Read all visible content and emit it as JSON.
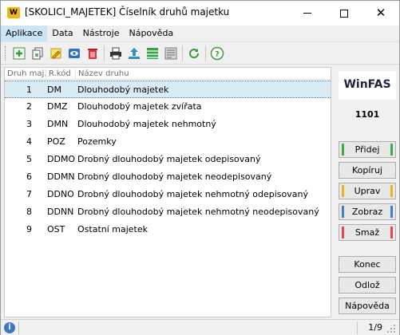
{
  "window": {
    "logo_text": "W",
    "title": "[SKOLICI_MAJETEK] Číselník druhů majetku"
  },
  "menu": [
    "Aplikace",
    "Data",
    "Nástroje",
    "Nápověda"
  ],
  "toolbar": {
    "icons": [
      "add-icon",
      "copy-icon",
      "edit-icon",
      "view-icon",
      "delete-icon",
      "print-icon",
      "export-icon",
      "table-icon",
      "form-icon",
      "refresh-icon",
      "help-icon"
    ]
  },
  "grid": {
    "columns": [
      "Druh maj.",
      "R.kód",
      "Název druhu"
    ],
    "rows": [
      {
        "num": "1",
        "code": "DM",
        "name": "Dlouhodobý majetek",
        "selected": true
      },
      {
        "num": "2",
        "code": "DMZ",
        "name": "Dlouhodobý majetek zvířata"
      },
      {
        "num": "3",
        "code": "DMN",
        "name": "Dlouhodobý majetek nehmotný"
      },
      {
        "num": "4",
        "code": "POZ",
        "name": "Pozemky"
      },
      {
        "num": "5",
        "code": "DDMO",
        "name": "Drobný dlouhodobý majetek odepisovaný"
      },
      {
        "num": "6",
        "code": "DDMN",
        "name": "Drobný dlouhodobý majetek neodepisovaný"
      },
      {
        "num": "7",
        "code": "DDNO",
        "name": "Drobný dlouhodobý majetek nehmotný odepisovaný"
      },
      {
        "num": "8",
        "code": "DDNN",
        "name": "Drobný dlouhodobý majetek nehmotný neodepisovaný"
      },
      {
        "num": "9",
        "code": "OST",
        "name": "Ostatní majetek"
      }
    ]
  },
  "side": {
    "brand": "WinFAS",
    "company_code": "1101",
    "buttons": {
      "add": "Přidej",
      "copy": "Kopíruj",
      "edit": "Uprav",
      "show": "Zobraz",
      "delete": "Smaž",
      "end": "Konec",
      "postpone": "Odlož",
      "help": "Nápověda"
    },
    "colors": {
      "add": "#3cab47",
      "edit": "#e8b321",
      "show": "#3d7fd0",
      "delete": "#e0474c"
    }
  },
  "status": {
    "info": "i",
    "pager": "1/9"
  }
}
